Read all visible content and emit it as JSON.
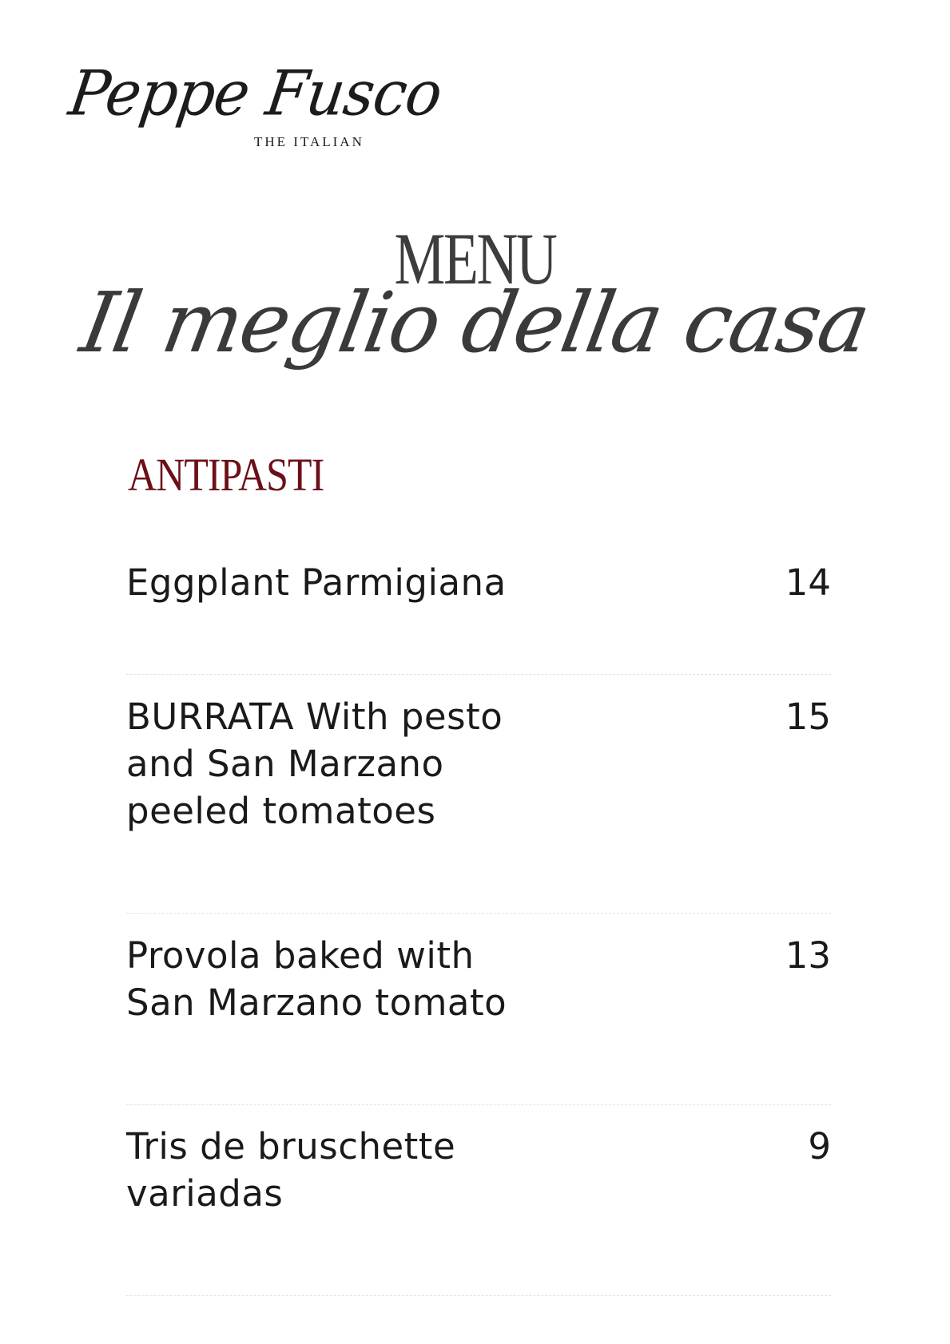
{
  "brand": {
    "name": "Peppe Fusco",
    "subtitle": "THE ITALIAN"
  },
  "header": {
    "title": "MENU",
    "tagline": "Il meglio della casa"
  },
  "section": {
    "title": "ANTIPASTI",
    "color": "#6b0f18"
  },
  "items": [
    {
      "name": "Eggplant Parmigiana",
      "price": "14"
    },
    {
      "name": "BURRATA With pesto and San Marzano peeled tomatoes",
      "price": "15"
    },
    {
      "name": "Provola baked with San Marzano tomato",
      "price": "13"
    },
    {
      "name": "Tris de bruschette variadas",
      "price": "9"
    }
  ]
}
